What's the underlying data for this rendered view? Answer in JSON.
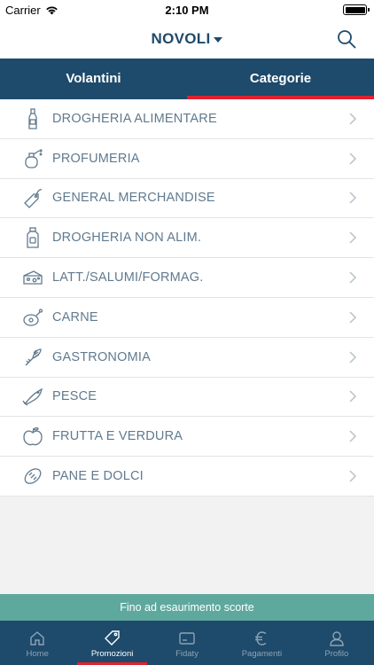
{
  "status_bar": {
    "carrier": "Carrier",
    "time": "2:10 PM"
  },
  "header": {
    "store": "NOVOLI"
  },
  "tabs": [
    {
      "label": "Volantini",
      "active": false
    },
    {
      "label": "Categorie",
      "active": true
    }
  ],
  "categories": [
    {
      "label": "DROGHERIA ALIMENTARE",
      "icon": "bottle-icon"
    },
    {
      "label": "PROFUMERIA",
      "icon": "perfume-icon"
    },
    {
      "label": "GENERAL MERCHANDISE",
      "icon": "tag-icon"
    },
    {
      "label": "DROGHERIA NON ALIM.",
      "icon": "detergent-icon"
    },
    {
      "label": "LATT./SALUMI/FORMAG.",
      "icon": "cheese-icon"
    },
    {
      "label": "CARNE",
      "icon": "meat-icon"
    },
    {
      "label": "GASTRONOMIA",
      "icon": "gastronomy-icon"
    },
    {
      "label": "PESCE",
      "icon": "fish-icon"
    },
    {
      "label": "FRUTTA E VERDURA",
      "icon": "apple-icon"
    },
    {
      "label": "PANE E DOLCI",
      "icon": "bread-icon"
    }
  ],
  "notice": "Fino ad esaurimento scorte",
  "bottom_nav": [
    {
      "label": "Home",
      "icon": "home-icon",
      "active": false
    },
    {
      "label": "Promozioni",
      "icon": "tag-icon",
      "active": true
    },
    {
      "label": "Fidaty",
      "icon": "card-icon",
      "active": false
    },
    {
      "label": "Pagamenti",
      "icon": "euro-icon",
      "active": false
    },
    {
      "label": "Profilo",
      "icon": "user-icon",
      "active": false
    }
  ],
  "colors": {
    "primary": "#1e4a6b",
    "accent": "#e0222f",
    "notice": "#5fa89e",
    "label": "#607a8f"
  }
}
